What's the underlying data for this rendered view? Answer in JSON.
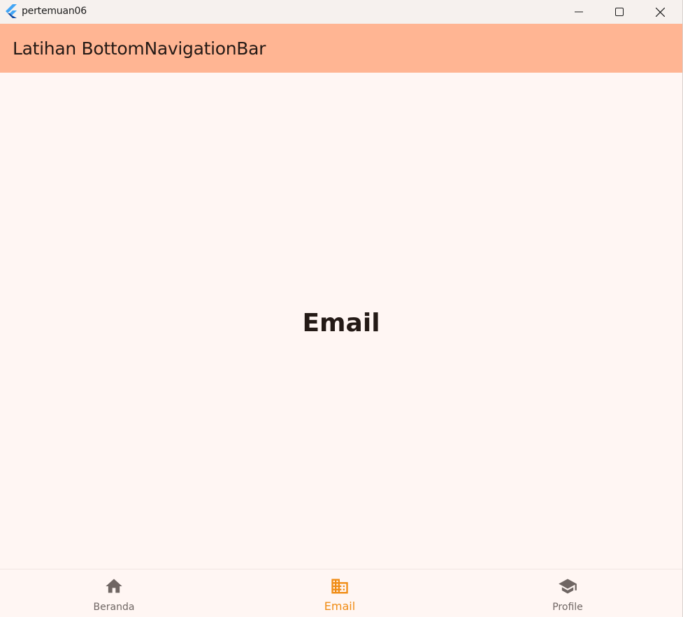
{
  "window": {
    "title": "pertemuan06"
  },
  "appbar": {
    "title": "Latihan BottomNavigationBar"
  },
  "content": {
    "page_label": "Email"
  },
  "bottom_nav": {
    "active_index": 1,
    "items": [
      {
        "label": "Beranda",
        "icon": "home-icon"
      },
      {
        "label": "Email",
        "icon": "business-icon"
      },
      {
        "label": "Profile",
        "icon": "school-icon"
      }
    ]
  },
  "colors": {
    "appbar_bg": "#ffb593",
    "background": "#fff6f3",
    "active": "#f08c14",
    "inactive": "#6f6663"
  }
}
